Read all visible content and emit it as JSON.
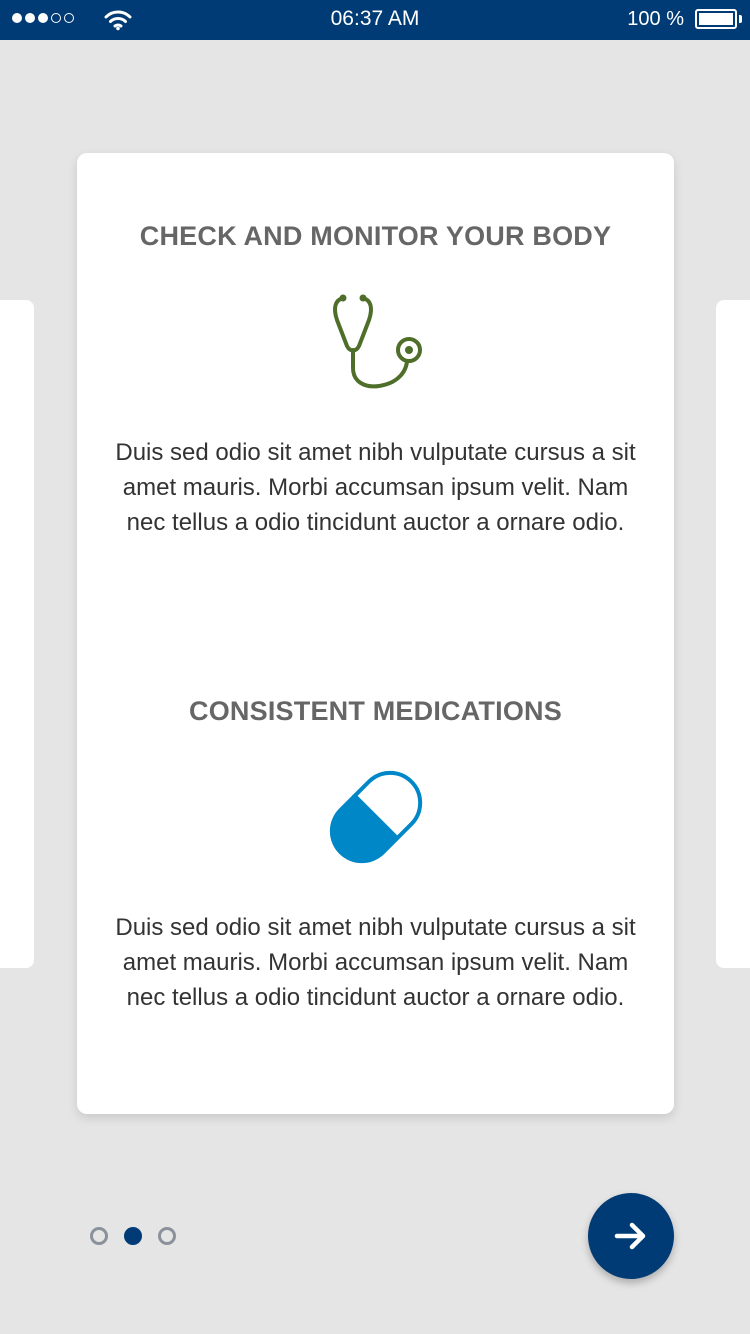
{
  "status_bar": {
    "time": "06:37 AM",
    "battery_percent_text": "100 %",
    "signal_bars_filled": 3,
    "signal_bars_total": 5,
    "battery_level": 1.0
  },
  "features": [
    {
      "title": "CHECK AND MONITOR YOUR BODY",
      "icon": "stethoscope-icon",
      "text": "Duis sed odio sit amet nibh vulputate cursus a sit amet mauris. Morbi accumsan ipsum velit. Nam nec tellus a odio tincidunt auctor a ornare odio."
    },
    {
      "title": "CONSISTENT MEDICATIONS",
      "icon": "pill-icon",
      "text": "Duis sed odio sit amet nibh vulputate cursus a sit amet mauris. Morbi accumsan ipsum velit. Nam nec tellus a odio tincidunt auctor a ornare odio."
    }
  ],
  "pager": {
    "total": 3,
    "active_index": 1
  },
  "colors": {
    "primary": "#003b75",
    "stethoscope": "#4f6e29",
    "pill": "#0087c8",
    "title_text": "#666666",
    "body_text": "#333333",
    "background": "#e5e5e5"
  },
  "next_button": {
    "icon": "arrow-right-icon"
  }
}
